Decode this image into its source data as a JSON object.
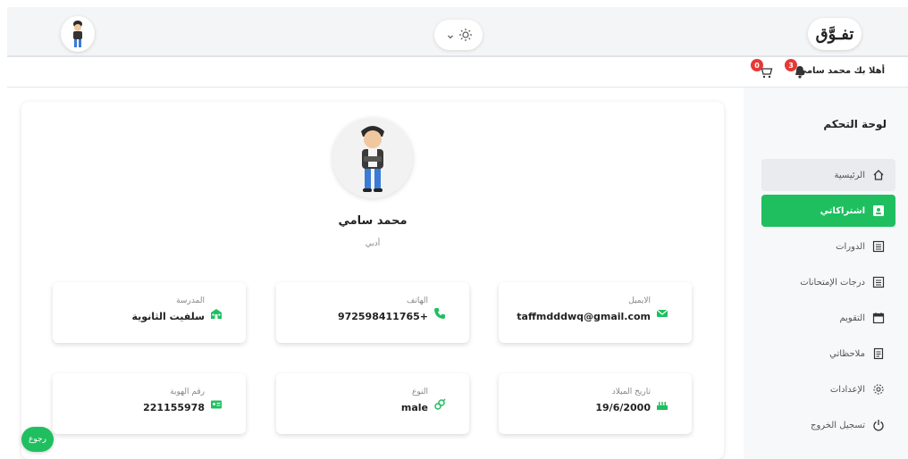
{
  "header": {
    "logo": "تفـوَّق",
    "theme_chevron": "⌄",
    "theme_icon": "sun-icon"
  },
  "subbar": {
    "greeting": "أهلا بك محمد سامي",
    "notifications_count": "3",
    "cart_count": "0"
  },
  "sidebar": {
    "title": "لوحة التحكم",
    "items": [
      {
        "label": "الرئيسية",
        "icon": "home-icon"
      },
      {
        "label": "اشتراكاتي",
        "icon": "id-card-icon"
      },
      {
        "label": "الدورات",
        "icon": "list-icon"
      },
      {
        "label": "درجات الإمتحانات",
        "icon": "list-icon"
      },
      {
        "label": "التقويم",
        "icon": "calendar-icon"
      },
      {
        "label": "ملاحظاتي",
        "icon": "notes-icon"
      },
      {
        "label": "الإعدادات",
        "icon": "gear-icon"
      },
      {
        "label": "تسجيل الخروج",
        "icon": "power-icon"
      }
    ]
  },
  "profile": {
    "name": "محمد سامي",
    "track": "أدبي",
    "fields": {
      "email": {
        "label": "الايميل",
        "value": "taffmdddwq@gmail.com",
        "icon": "mail-icon"
      },
      "phone": {
        "label": "الهاتف",
        "value": "972598411765+",
        "icon": "phone-icon"
      },
      "school": {
        "label": "المدرسة",
        "value": "سلفيت الثانوية",
        "icon": "school-icon"
      },
      "birthdate": {
        "label": "تاريخ الميلاد",
        "value": "19/6/2000",
        "icon": "cake-icon"
      },
      "gender": {
        "label": "النوع",
        "value": "male",
        "icon": "gender-icon"
      },
      "id_number": {
        "label": "رقم الهوية",
        "value": "221155978",
        "icon": "id-icon"
      }
    }
  },
  "back_button": "رجوع",
  "colors": {
    "accent": "#1fbf5f",
    "badge": "#e53935"
  }
}
